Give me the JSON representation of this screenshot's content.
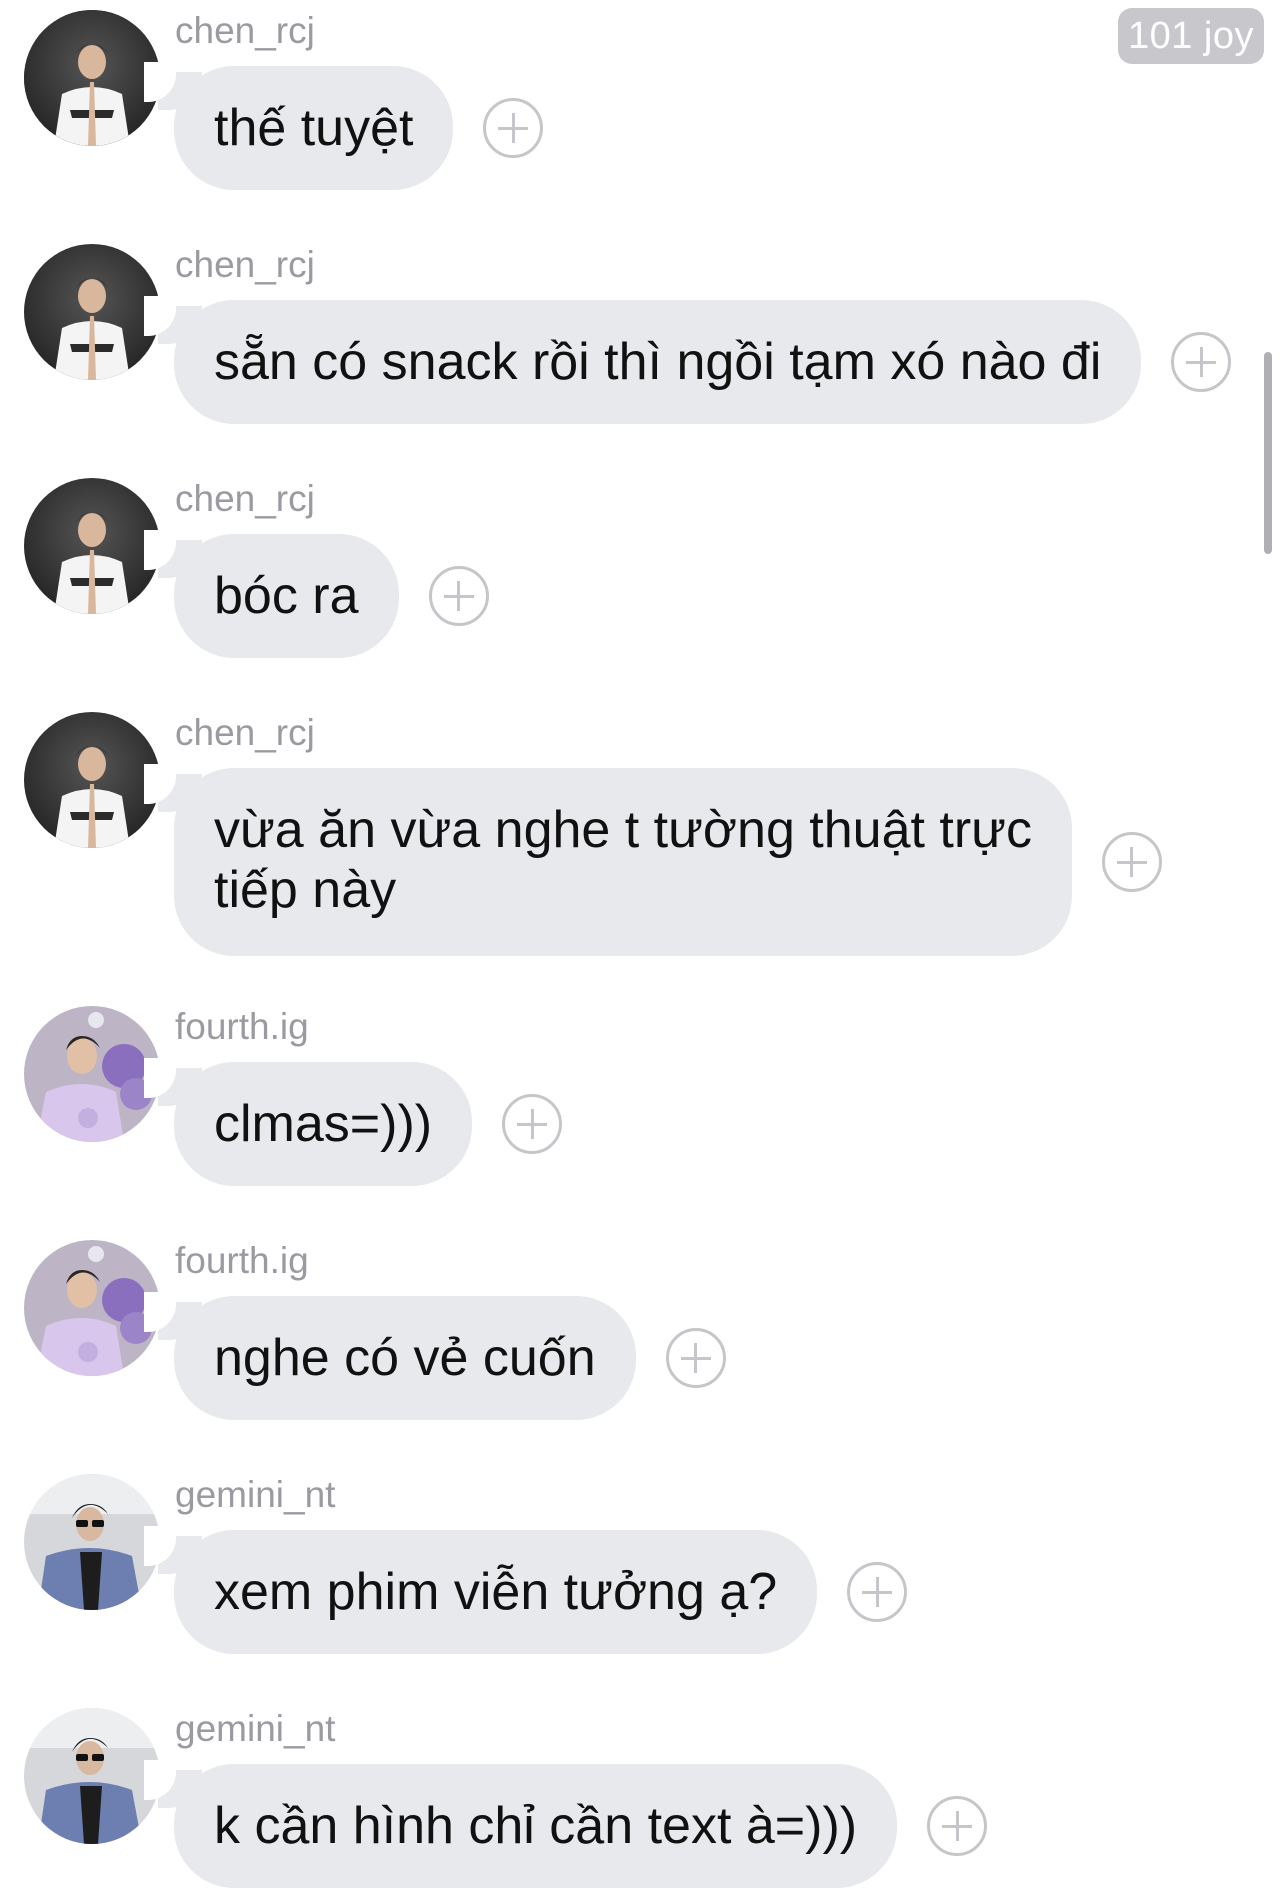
{
  "header": {
    "badge": "101 joy"
  },
  "messages": [
    {
      "username": "chen_rcj",
      "text": "thế tuyệt",
      "avatar": "chen-avatar"
    },
    {
      "username": "chen_rcj",
      "text": "sẵn có snack rồi thì ngồi tạm xó nào đi",
      "avatar": "chen-avatar"
    },
    {
      "username": "chen_rcj",
      "text": "bóc ra",
      "avatar": "chen-avatar"
    },
    {
      "username": "chen_rcj",
      "text": "vừa ăn vừa nghe t tường thuật trực",
      "text2": "tiếp này",
      "avatar": "chen-avatar"
    },
    {
      "username": "fourth.ig",
      "text": "clmas=)))",
      "avatar": "fourth-avatar"
    },
    {
      "username": "fourth.ig",
      "text": "nghe có vẻ cuốn",
      "avatar": "fourth-avatar"
    },
    {
      "username": "gemini_nt",
      "text": "xem phim viễn tưởng ạ?",
      "avatar": "gemini-avatar"
    },
    {
      "username": "gemini_nt",
      "text": "k cần hình chỉ cần text à=)))",
      "avatar": "gemini-avatar"
    }
  ],
  "colors": {
    "bubble": "#e8e9ec",
    "username": "#9a9aa0",
    "text": "#111111",
    "react_icon": "#c6c6ca",
    "badge": "#c8c8cc"
  },
  "icons": {
    "react": "add-reaction-icon"
  }
}
